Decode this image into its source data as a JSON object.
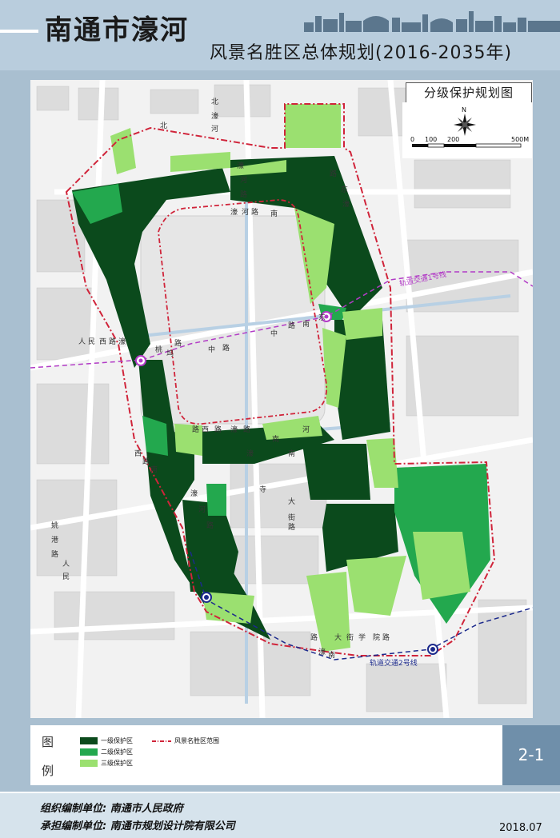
{
  "header": {
    "title_main": "南通市濠河",
    "title_sub": "风景名胜区总体规划(2016-2035年)"
  },
  "map": {
    "title": "分级保护规划图",
    "compass_label": "N",
    "scale_labels": [
      "0",
      "100",
      "200",
      "500M"
    ],
    "line_labels": {
      "metro1": "轨道交通1号线",
      "metro2": "轨道交通2号线"
    },
    "road_labels": [
      "濠",
      "河",
      "路",
      "北",
      "濠",
      "河",
      "路",
      "东",
      "濠",
      "南",
      "大",
      "街",
      "寺",
      "路",
      "桃",
      "坞",
      "路",
      "姚",
      "港",
      "路",
      "人",
      "民",
      "中",
      "路",
      "中",
      "路",
      "南",
      "东",
      "濠",
      "南",
      "河",
      "路",
      "濠",
      "南",
      "路",
      "西",
      "路",
      "濠",
      "路",
      "北",
      "濠",
      "河",
      "路",
      "南",
      "大",
      "街",
      "学",
      "院",
      "路",
      "濠",
      "河",
      "路",
      "人",
      "民",
      "西",
      "路",
      "濠",
      "西",
      "路",
      "南"
    ],
    "colors": {
      "level1": "#0b4a1c",
      "level2": "#23a84e",
      "level3": "#9be070",
      "boundary": "#d0243a",
      "metro1": "#b23bc6",
      "metro2": "#1c2a8c"
    }
  },
  "legend": {
    "label_top": "图",
    "label_bottom": "例",
    "items": [
      {
        "key": "level1",
        "text": "一级保护区"
      },
      {
        "key": "level2",
        "text": "二级保护区"
      },
      {
        "key": "level3",
        "text": "三级保护区"
      },
      {
        "key": "boundary",
        "text": "风景名胜区范围"
      }
    ]
  },
  "page_number": "2-1",
  "footer": {
    "org1": "组织编制单位: 南通市人民政府",
    "org2": "承担编制单位: 南通市规划设计院有限公司",
    "date": "2018.07"
  }
}
